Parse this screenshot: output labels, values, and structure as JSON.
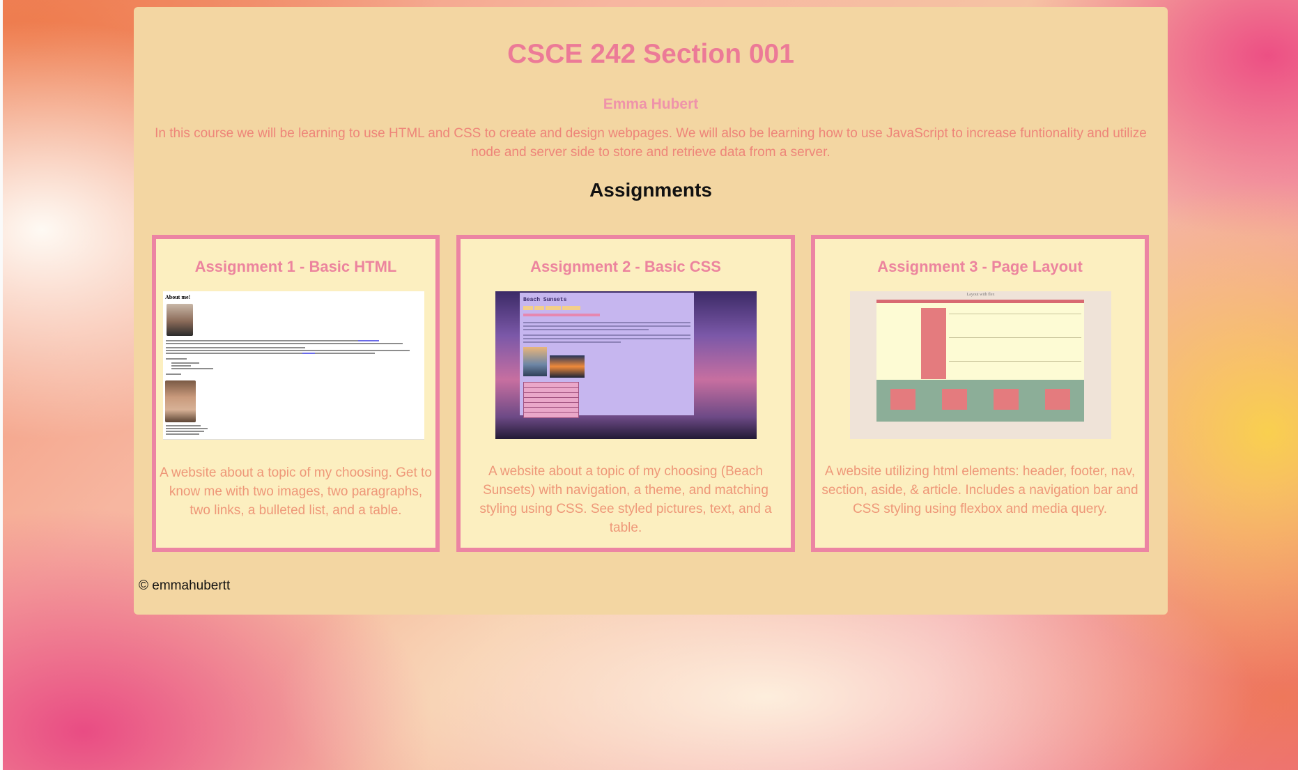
{
  "header": {
    "course_title": "CSCE 242 Section 001",
    "author": "Emma Hubert",
    "intro": "In this course we will be learning to use HTML and CSS to create and design webpages. We will also be learning how to use JavaScript to increase funtionality and utilize node and server side to store and retrieve data from a server."
  },
  "section": {
    "title": "Assignments"
  },
  "assignments": [
    {
      "title": "Assignment 1 - Basic HTML",
      "description": "A website about a topic of my choosing. Get to know me with two images, two paragraphs, two links, a bulleted list, and a table.",
      "thumbnail_heading": "About me!"
    },
    {
      "title": "Assignment 2 - Basic CSS",
      "description": "A website about a topic of my choosing (Beach Sunsets) with navigation, a theme, and matching styling using CSS. See styled pictures, text, and a table.",
      "thumbnail_heading": "Beach Sunsets"
    },
    {
      "title": "Assignment 3 - Page Layout",
      "description": "A website utilizing html elements: header, footer, nav, section, aside, & article. Includes a navigation bar and CSS styling using flexbox and media query.",
      "thumbnail_heading": "Layout with flex"
    }
  ],
  "footer": {
    "text": "© emmahubertt"
  },
  "colors": {
    "panel": "#f3d6a2",
    "card_bg": "#fcefc0",
    "card_border": "#ec84a3",
    "title_pink": "#ec7a97",
    "text_coral": "#ee8579"
  }
}
